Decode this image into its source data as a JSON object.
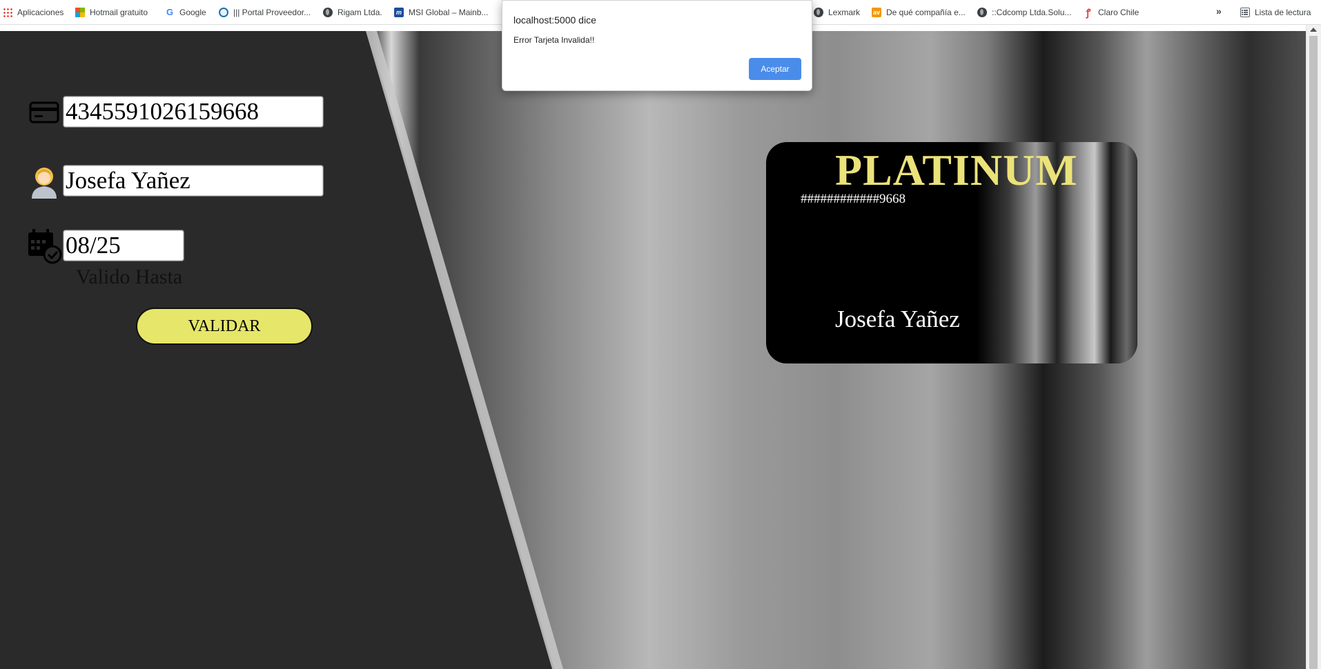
{
  "bookmarks": {
    "items": [
      {
        "label": "Aplicaciones",
        "icon": "apps-grid-icon"
      },
      {
        "label": "Hotmail gratuito",
        "icon": "microsoft-icon"
      },
      {
        "label": "Google",
        "icon": "google-icon"
      },
      {
        "label": "||| Portal Proveedor...",
        "icon": "portal-icon"
      },
      {
        "label": "Rigam Ltda.",
        "icon": "globe-icon"
      },
      {
        "label": "MSI Global – Mainb...",
        "icon": "msi-icon"
      },
      {
        "label": "Lexmark",
        "icon": "globe-icon"
      },
      {
        "label": "De qué compañía e...",
        "icon": "av-icon"
      },
      {
        "label": "::Cdcomp Ltda.Solu...",
        "icon": "globe-icon"
      },
      {
        "label": "Claro Chile",
        "icon": "claro-icon"
      }
    ],
    "more": "»",
    "reading_list": "Lista de lectura"
  },
  "dialog": {
    "title": "localhost:5000 dice",
    "message": "Error Tarjeta Invalida!!",
    "ok_label": "Aceptar"
  },
  "form": {
    "card_number": "4345591026159668",
    "holder_name": "Josefa Yañez",
    "expiry": "08/25",
    "expiry_label": "Valido Hasta",
    "submit_label": "VALIDAR"
  },
  "card": {
    "title": "PLATINUM",
    "masked_number": "############9668",
    "holder": "Josefa Yañez"
  },
  "colors": {
    "accent_yellow": "#e6e66a",
    "card_title": "#ebe27a",
    "dialog_button": "#4a8cea",
    "page_background": "#2a2a2a"
  }
}
